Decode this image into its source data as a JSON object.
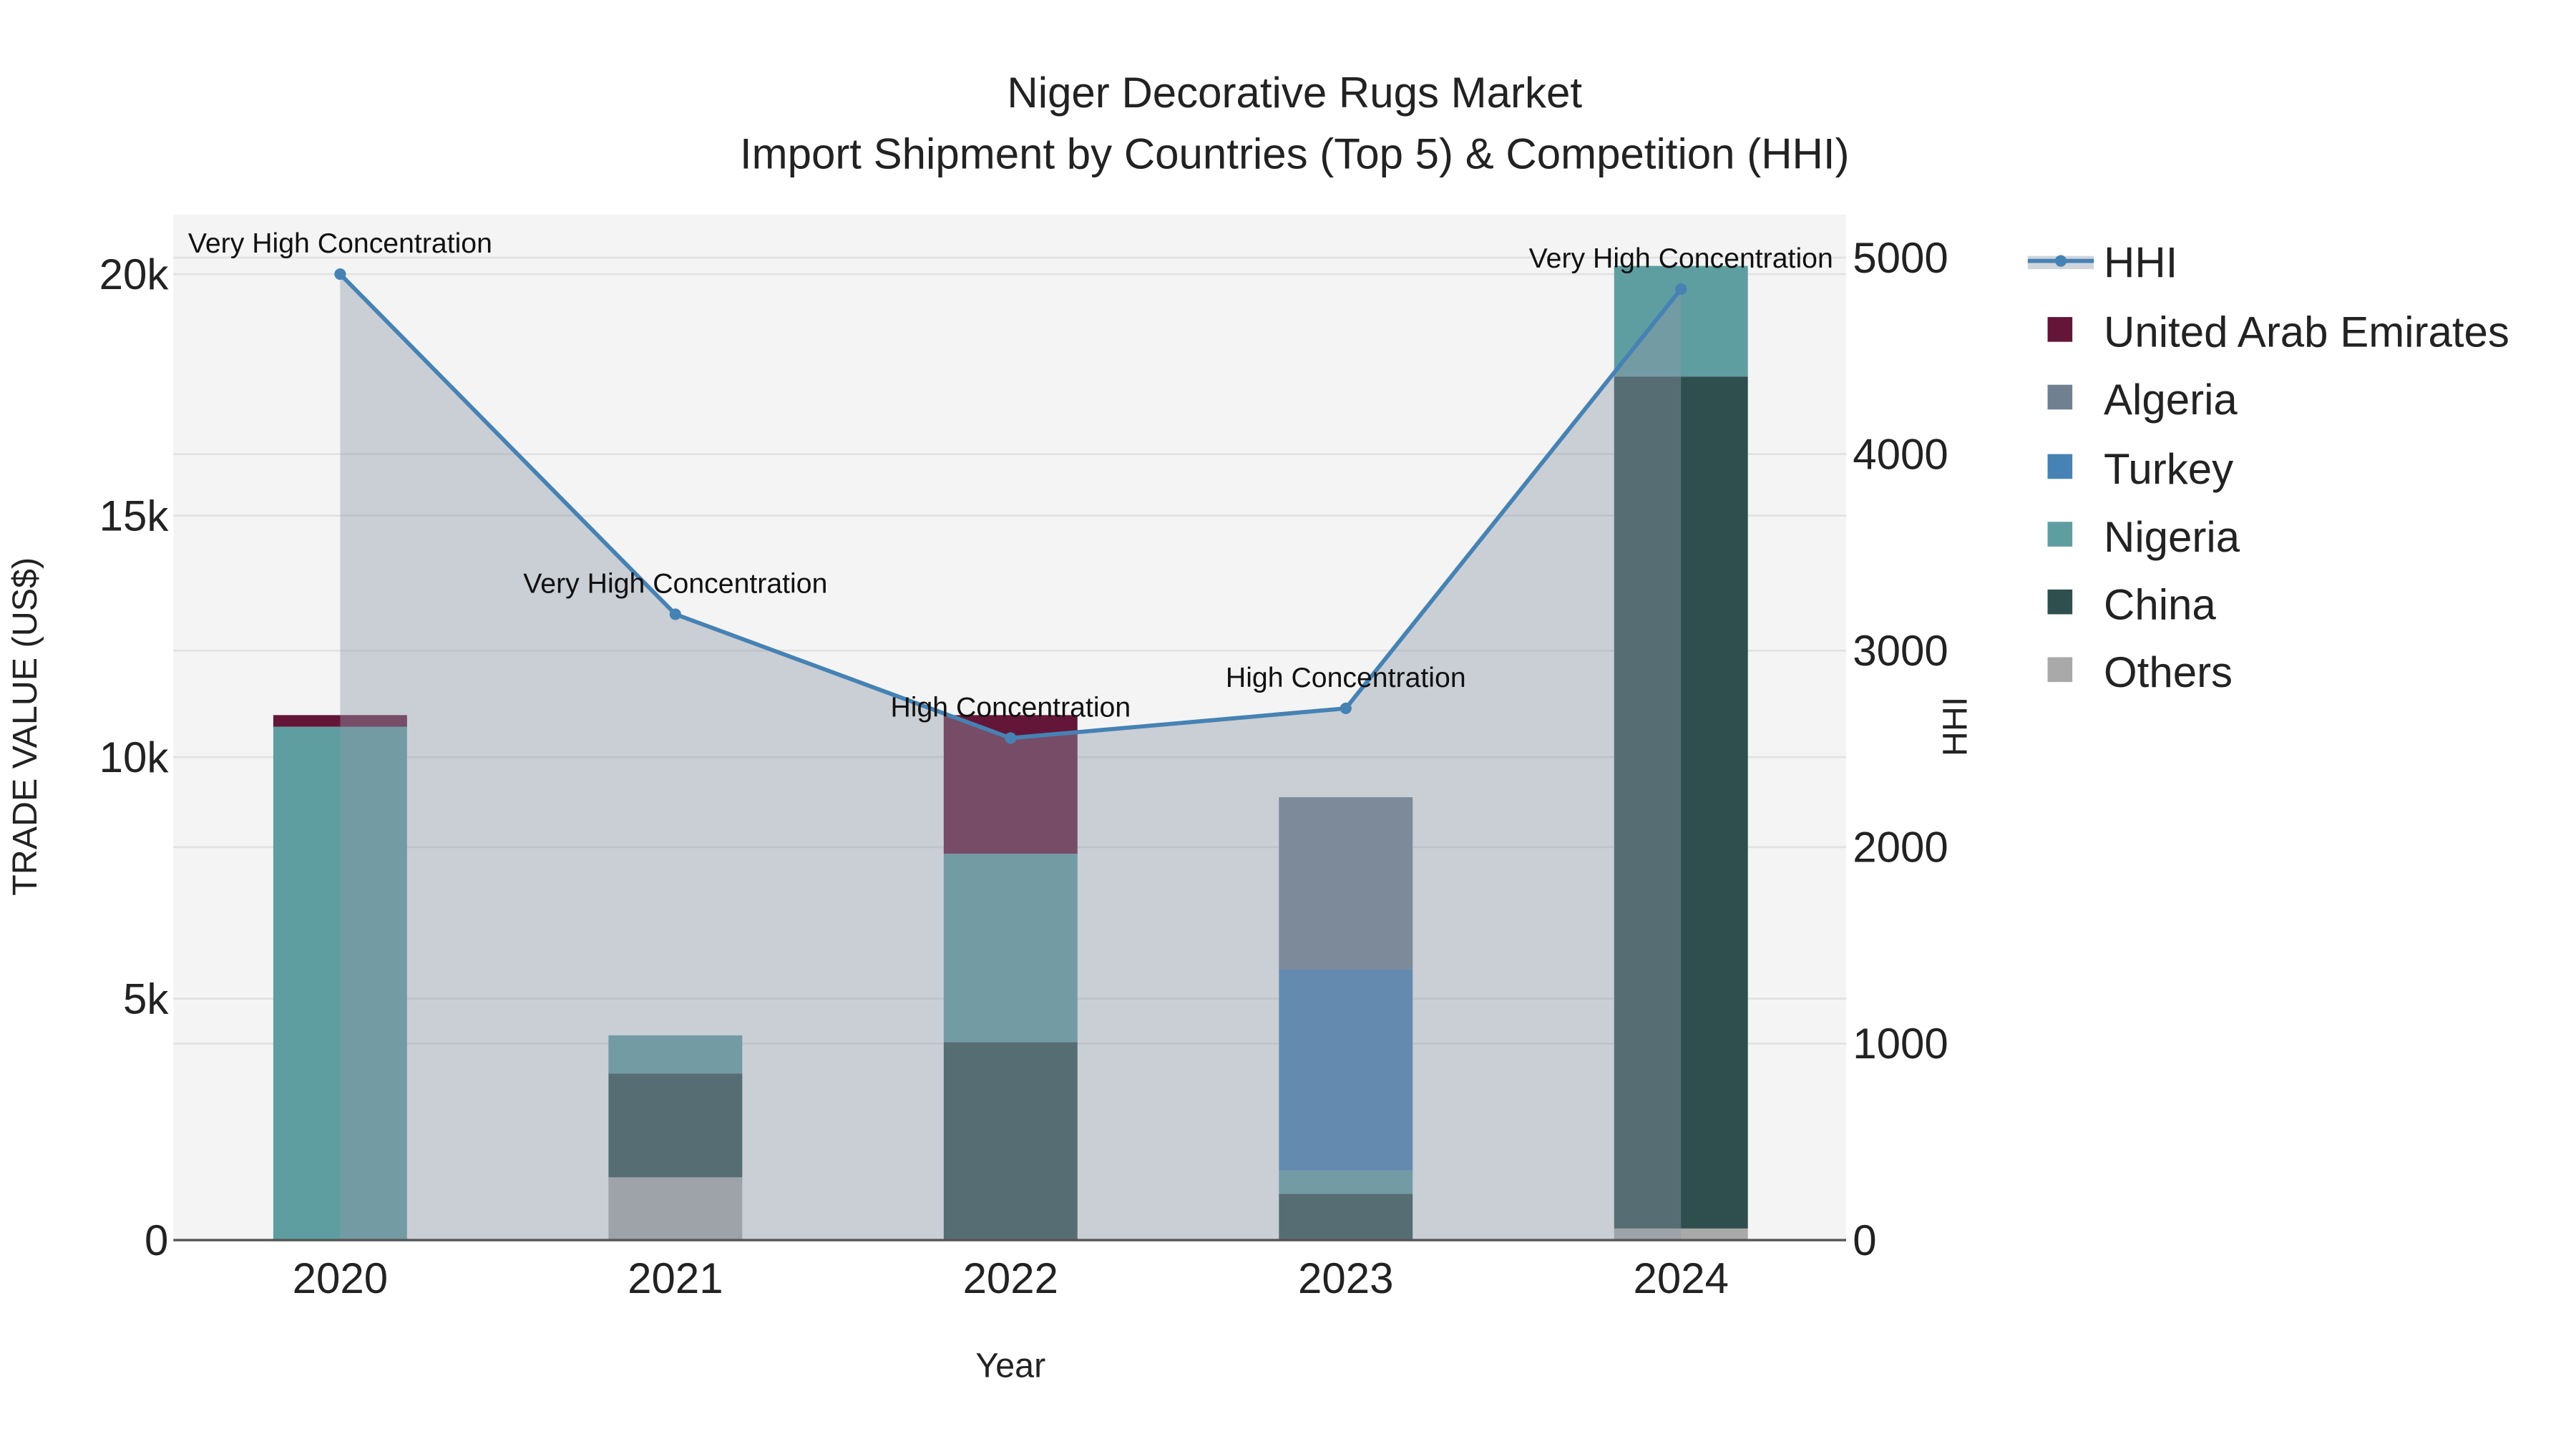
{
  "chart_data": {
    "type": "bar",
    "title": "Niger Decorative Rugs Market",
    "subtitle": "Import Shipment by Countries (Top 5) & Competition (HHI)",
    "xlabel": "Year",
    "ylabel": "TRADE VALUE (US$)",
    "y2label": "HHI",
    "categories": [
      "2020",
      "2021",
      "2022",
      "2023",
      "2024"
    ],
    "ylim": [
      0,
      21000
    ],
    "y2lim": [
      0,
      5200
    ],
    "yticks": [
      0,
      5000,
      10000,
      15000,
      20000
    ],
    "ytick_labels": [
      "0",
      "5k",
      "10k",
      "15k",
      "20k"
    ],
    "y2ticks": [
      0,
      1000,
      2000,
      3000,
      4000,
      5000
    ],
    "y2tick_labels": [
      "0",
      "1000",
      "2000",
      "3000",
      "4000",
      "5000"
    ],
    "grid": true,
    "legend_placement": "right",
    "stacked": true,
    "series": [
      {
        "name": "Others",
        "color": "#A9A9A9",
        "values": [
          0,
          1300,
          0,
          0,
          240
        ]
      },
      {
        "name": "China",
        "color": "#2F4F4F",
        "values": [
          0,
          2150,
          4100,
          960,
          17640
        ]
      },
      {
        "name": "Nigeria",
        "color": "#5F9EA0",
        "values": [
          10630,
          790,
          3900,
          480,
          2290
        ]
      },
      {
        "name": "Turkey",
        "color": "#4682B4",
        "values": [
          0,
          0,
          0,
          4170,
          0
        ]
      },
      {
        "name": "Algeria",
        "color": "#708090",
        "values": [
          0,
          0,
          0,
          3560,
          0
        ]
      },
      {
        "name": "United Arab Emirates",
        "color": "#641638",
        "values": [
          240,
          0,
          2870,
          0,
          0
        ]
      }
    ],
    "hhi": {
      "name": "HHI",
      "color": "#4682B4",
      "values": [
        4916,
        3185,
        2555,
        2706,
        4840
      ],
      "annotations": [
        "Very High Concentration",
        "Very High Concentration",
        "High Concentration",
        "High Concentration",
        "Very High Concentration"
      ]
    },
    "legend_order": [
      "HHI",
      "United Arab Emirates",
      "Algeria",
      "Turkey",
      "Nigeria",
      "China",
      "Others"
    ]
  }
}
